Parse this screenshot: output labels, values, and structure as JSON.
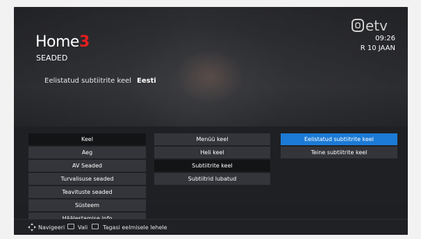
{
  "header": {
    "brand": "Home",
    "brand_number": "3",
    "page_title": "SEADED",
    "channel_logo": "etv",
    "time": "09:26",
    "date": "R 10 JAAN"
  },
  "preference": {
    "label": "Eelistatud subtiitrite keel",
    "value": "Eesti"
  },
  "menu": {
    "col1": [
      "Keel",
      "Aeg",
      "AV Seaded",
      "Turvalisuse seaded",
      "Teavituste seaded",
      "Süsteem",
      "Häälestamise info"
    ],
    "col2": [
      "Menüü keel",
      "Heli keel",
      "Subtiitrite keel",
      "Subtiitrid lubatud"
    ],
    "col3": [
      "Eelistatud subtiitrite keel",
      "Teine subtiitrite keel"
    ]
  },
  "footer": {
    "navigate": "Navigeeri",
    "select": "Vali",
    "back": "Tagasi eelmisele lehele"
  },
  "colors": {
    "accent": "#1c7bd6",
    "brand_red": "#e41e1e"
  }
}
